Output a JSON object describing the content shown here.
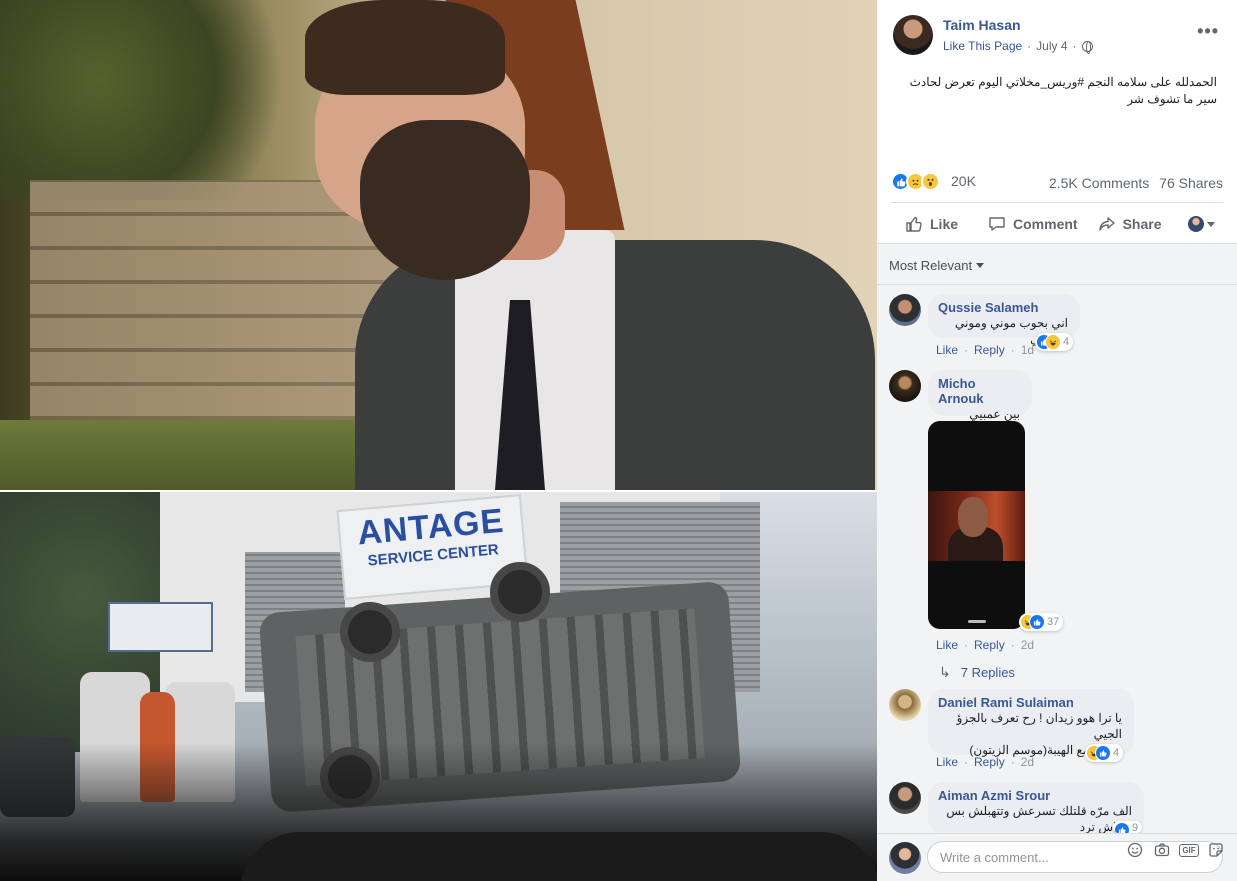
{
  "post": {
    "author": "Taim Hasan",
    "like_page": "Like This Page",
    "separator": "·",
    "date": "July 4",
    "text": "الحمدلله على سلامه النجم #وريس_مخلاتي اليوم تعرض لحادث سير ما تشوف شر",
    "reactions_count": "20K",
    "comments_count": "2.5K Comments",
    "shares_count": "76 Shares",
    "more_label": "•••"
  },
  "actions": {
    "like": "Like",
    "comment": "Comment",
    "share": "Share"
  },
  "sort": {
    "label": "Most Relevant"
  },
  "comments": [
    {
      "name": "Qussie Salameh",
      "text": "اني بحوب موني وموني بتحوبني",
      "like": "Like",
      "reply": "Reply",
      "time": "1d",
      "reactions": "4"
    },
    {
      "name": "Micho Arnouk",
      "text": "بين عمبيي",
      "like": "Like",
      "reply": "Reply",
      "time": "2d",
      "reactions": "37"
    },
    {
      "name": "Daniel Rami Sulaiman",
      "text_line1": "يا ترا هوو زيدان ! رح تعرف بالجزؤ الجيي",
      "text_line2": "تابعونا مع الهيبة(موسم الزيتون)",
      "like": "Like",
      "reply": "Reply",
      "time": "2d",
      "reactions": "4"
    },
    {
      "name": "Aiman Azmi Srour",
      "text": "الف مرّه قلتلك تسرعش وتتهبلش بس بدكاش ترد",
      "reactions": "9"
    }
  ],
  "replies": {
    "label": "7 Replies"
  },
  "composer": {
    "placeholder": "Write a comment..."
  },
  "photo": {
    "sign_title": "ANTAGE",
    "sign_subtitle": "SERVICE CENTER"
  },
  "colors": {
    "link": "#385898",
    "like_blue": "#1877f2",
    "bg": "#f2f3f5"
  }
}
